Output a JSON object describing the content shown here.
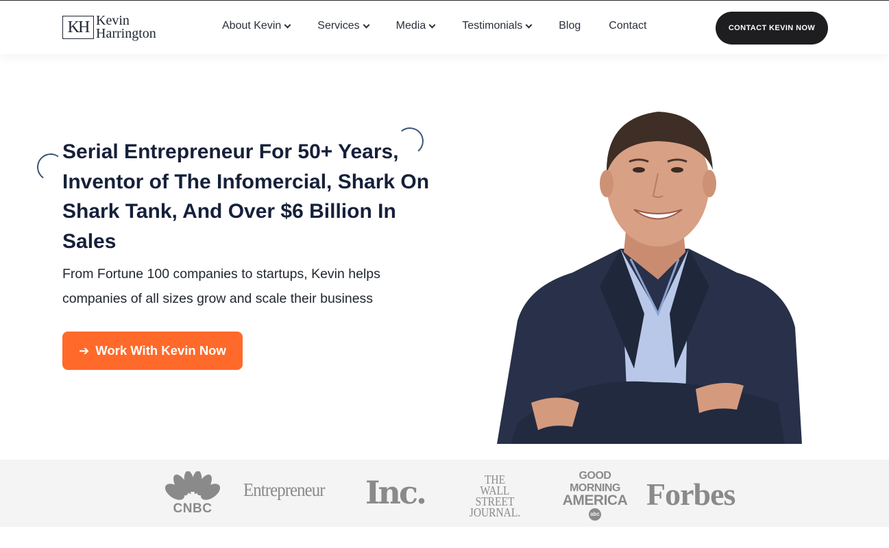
{
  "header": {
    "logo_mark": "KH",
    "logo_line1": "Kevin",
    "logo_line2": "Harrington",
    "nav": [
      {
        "label": "About Kevin"
      },
      {
        "label": "Services"
      },
      {
        "label": "Media"
      },
      {
        "label": "Testimonials"
      },
      {
        "label": "Blog"
      },
      {
        "label": "Contact"
      }
    ],
    "cta_label": "CONTACT KEVIN NOW"
  },
  "hero": {
    "headline": "Serial Entrepreneur For 50+ Years, Inventor of The Infomercial, Shark On Shark Tank, And Over $6 Billion In Sales",
    "subtext": "From Fortune 100 companies to startups, Kevin helps companies of all sizes grow and scale their business",
    "cta_label": "Work With Kevin Now",
    "cta_icon": "arrow-right-icon"
  },
  "press": {
    "cnbc": "CNBC",
    "entrepreneur": "Entrepreneur",
    "inc": "Inc.",
    "wsj_line1": "THE",
    "wsj_line2": "WALL STREET",
    "wsj_line3": "JOURNAL.",
    "gma_line1": "GOOD",
    "gma_line2": "MORNING",
    "gma_line3": "AMERICA",
    "gma_badge": "abc",
    "forbes": "Forbes"
  },
  "colors": {
    "accent": "#ff6a2b",
    "dark": "#1e1e20",
    "headline": "#16203a",
    "press_gray": "#8a8a8a"
  }
}
